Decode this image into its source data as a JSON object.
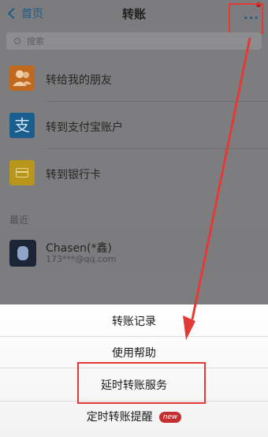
{
  "navbar": {
    "back_label": "首页",
    "title": "转账",
    "more_label": "···"
  },
  "search": {
    "placeholder": "搜索"
  },
  "transfer_options": [
    {
      "label": "转给我的朋友",
      "icon": "friends-icon",
      "color": "#bf6a1f"
    },
    {
      "label": "转到支付宝账户",
      "icon": "alipay-icon",
      "color": "#1a5e8f"
    },
    {
      "label": "转到银行卡",
      "icon": "bank-card-icon",
      "color": "#b8961b"
    }
  ],
  "recent": {
    "section_title": "最近",
    "contact": {
      "name": "Chasen(*鑫)",
      "account": "173***@qq.com"
    }
  },
  "action_sheet": {
    "items": [
      {
        "label": "转账记录"
      },
      {
        "label": "使用帮助"
      },
      {
        "label": "延时转账服务"
      },
      {
        "label": "定时转账提醒",
        "badge": "new"
      }
    ]
  },
  "annotation_color": "#e23a36"
}
